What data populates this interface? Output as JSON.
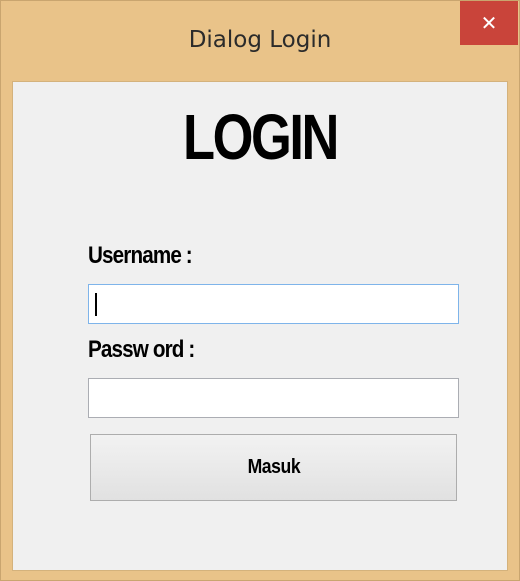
{
  "window": {
    "title": "Dialog Login",
    "close_symbol": "✕"
  },
  "form": {
    "heading": "LOGIN",
    "username_label": "Username :",
    "username_value": "",
    "password_label": "Passw ord :",
    "password_value": "",
    "submit_label": "Masuk"
  },
  "colors": {
    "titlebar": "#e9c389",
    "close_button": "#c9443a",
    "client_background": "#f0f0f0",
    "focused_input_border": "#7eb4ea"
  },
  "icons": {
    "close": "close-icon"
  }
}
